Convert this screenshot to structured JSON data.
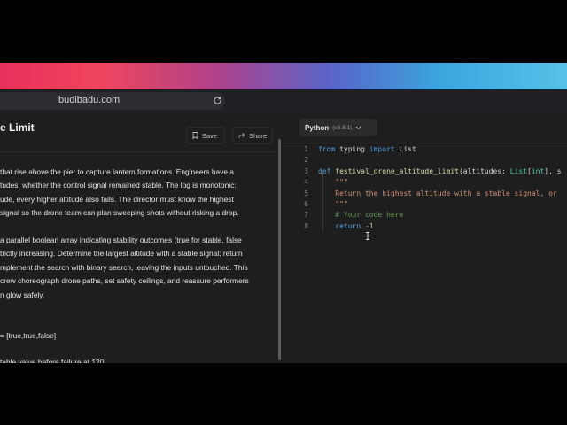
{
  "browser": {
    "url": "budibadu.com"
  },
  "problem": {
    "title_fragment": "e Limit",
    "save_label": "Save",
    "share_label": "Share",
    "description_lines": [
      "that rise above the pier to capture lantern formations. Engineers have a",
      "tudes, whether the control signal remained stable. The log is monotonic:",
      "ude, every higher altitude also fails. The director must know the highest",
      "signal so the drone team can plan sweeping shots without risking a drop.",
      "",
      "a parallel boolean array indicating stability outcomes (true for stable, false",
      "trictly increasing. Determine the largest altitude with a stable signal; return",
      "mplement the search with binary search, leaving the inputs untouched. This",
      "crew choreograph drone paths, set safety ceilings, and reassure performers",
      "n glow safely.",
      "",
      "",
      "= [true,true,false]",
      "",
      "table value before failure at 120."
    ]
  },
  "editor": {
    "language": "Python",
    "version": "(v3.8.1)",
    "line_numbers": [
      "1",
      "2",
      "3",
      "4",
      "5",
      "6",
      "7",
      "8"
    ],
    "code": {
      "l1_from": "from",
      "l1_module": " typing ",
      "l1_import": "import",
      "l1_name": " List",
      "l3_def": "def",
      "l3_fn": " festival_drone_altitude_limit",
      "l3_open": "(altitudes: ",
      "l3_list": "List",
      "l3_bracket_open": "[",
      "l3_int": "int",
      "l3_rest": "], s",
      "l4": "    \"\"\"",
      "l5": "    Return the highest altitude with a stable signal, or",
      "l6": "    \"\"\"",
      "l7": "    # Your code here",
      "l8_return": "return",
      "l8_val": " -1"
    }
  }
}
